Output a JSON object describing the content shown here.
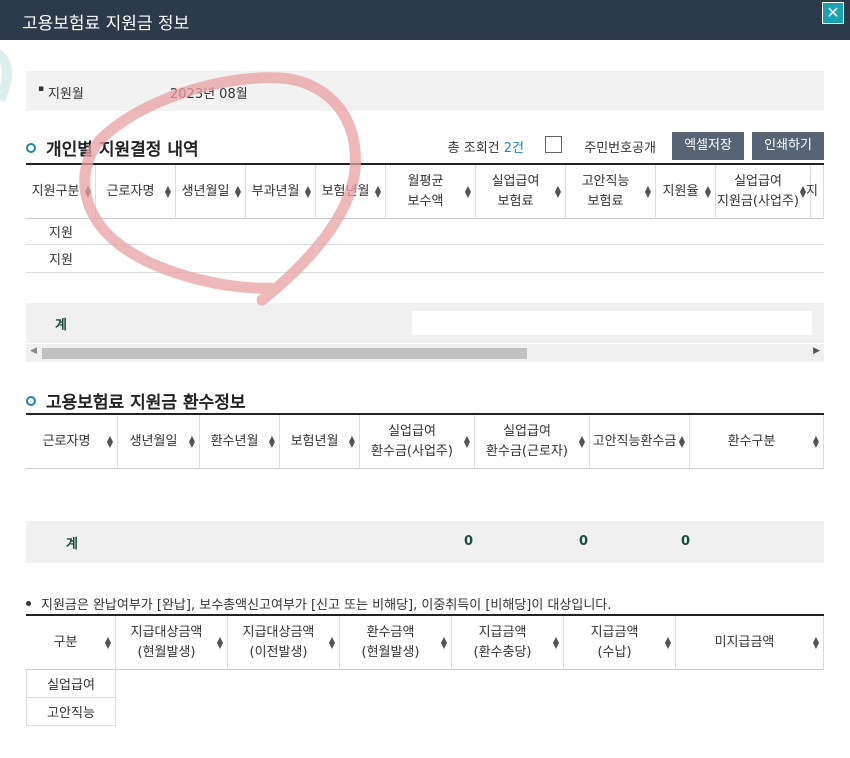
{
  "window": {
    "title": "고용보험료 지원금 정보",
    "close_glyph": "✕"
  },
  "support_month": {
    "label": "지원월",
    "value": "2023년 08월"
  },
  "section1": {
    "title": "개인별 지원결정 내역",
    "count_prefix": "총 조회건",
    "count_value": "2건",
    "checkbox_label": "주민번호공개",
    "excel_button": "엑셀저장",
    "print_button": "인쇄하기",
    "columns": [
      [
        "지원구분"
      ],
      [
        "근로자명"
      ],
      [
        "생년월일"
      ],
      [
        "부과년월"
      ],
      [
        "보험년월"
      ],
      [
        "월평균",
        "보수액"
      ],
      [
        "실업급여",
        "보험료"
      ],
      [
        "고안직능",
        "보험료"
      ],
      [
        "지원율"
      ],
      [
        "실업급여",
        "지원금(사업주)"
      ],
      [
        "지"
      ]
    ],
    "rows": [
      "지원",
      "지원"
    ],
    "total_label": "계"
  },
  "section2": {
    "title": "고용보험료 지원금 환수정보",
    "columns": [
      [
        "근로자명"
      ],
      [
        "생년월일"
      ],
      [
        "환수년월"
      ],
      [
        "보험년월"
      ],
      [
        "실업급여",
        "환수금(사업주)"
      ],
      [
        "실업급여",
        "환수금(근로자)"
      ],
      [
        "고안직능환수금"
      ],
      [
        "환수구분"
      ]
    ],
    "total_label": "계",
    "totals": [
      "0",
      "0",
      "0"
    ]
  },
  "note": "지원금은 완납여부가 [완납], 보수총액신고여부가 [신고 또는 비해당], 이중취득이 [비해당]이 대상입니다.",
  "section3": {
    "columns": [
      [
        "구분"
      ],
      [
        "지급대상금액",
        "(현월발생)"
      ],
      [
        "지급대상금액",
        "(이전발생)"
      ],
      [
        "환수금액",
        "(현월발생)"
      ],
      [
        "지급금액",
        "(환수충당)"
      ],
      [
        "지급금액",
        "(수납)"
      ],
      [
        "미지급금액"
      ]
    ],
    "rows": [
      "실업급여",
      "고안직능"
    ]
  },
  "colors": {
    "titlebar": "#2d3a4b",
    "accent": "#1e86a8",
    "button": "#566476",
    "close": "#18a3b4"
  }
}
